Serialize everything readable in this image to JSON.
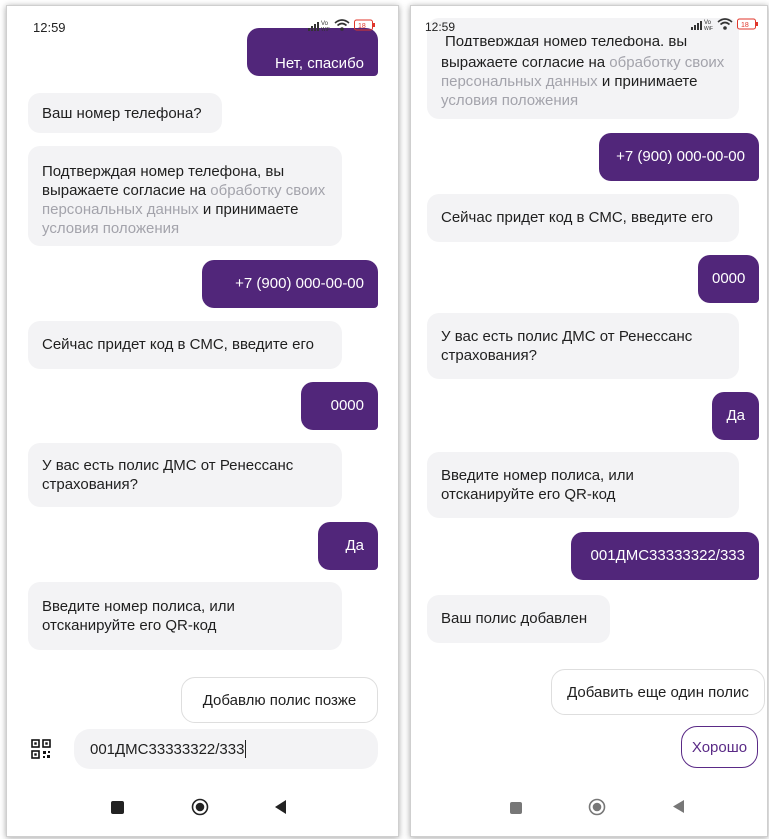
{
  "left": {
    "time": "12:59",
    "messages": {
      "m0": "Нет, спасибо",
      "m1": "Ваш номер телефона?",
      "m2a": "Подтверждая номер телефона, вы выражаете согласие на ",
      "m2link1": "обработку своих персональных данных",
      "m2b": " и принимаете ",
      "m2link2": "условия положения",
      "m3": "+7  (900) 000-00-00",
      "m4": "Сейчас придет код в СМС, введите его",
      "m5": "0000",
      "m6": "У вас есть полис ДМС от Ренессанс страхования?",
      "m7": "Да",
      "m8": "Введите номер полиса, или отсканируйте его QR-код"
    },
    "chip": "Добавлю полис позже",
    "input_value": "001ДМС33333322/333"
  },
  "right": {
    "time": "12:59",
    "messages": {
      "m0top": "Подтверждая номер телефона, вы",
      "m0a": "выражаете согласие на ",
      "m0link1": "обработку своих персональных данных",
      "m0b": " и принимаете ",
      "m0link2": "условия положения",
      "m1": "+7  (900) 000-00-00",
      "m2": "Сейчас придет код в СМС, введите его",
      "m3": "0000",
      "m4": "У вас есть полис ДМС от Ренессанс страхования?",
      "m5": "Да",
      "m6": "Введите номер полиса, или отсканируйте его QR-код",
      "m7": "001ДМС33333322/333",
      "m8": "Ваш полис добавлен"
    },
    "chip1": "Добавить еще один полис",
    "chip2": "Хорошо"
  },
  "colors": {
    "accent": "#51267a",
    "bubble_in": "#f3f3f5",
    "link_dim": "#a3a3ab"
  },
  "icons": [
    "signal-icon",
    "wifi-icon",
    "battery-icon",
    "qr-scan-icon",
    "recents-icon",
    "home-icon",
    "back-icon"
  ]
}
